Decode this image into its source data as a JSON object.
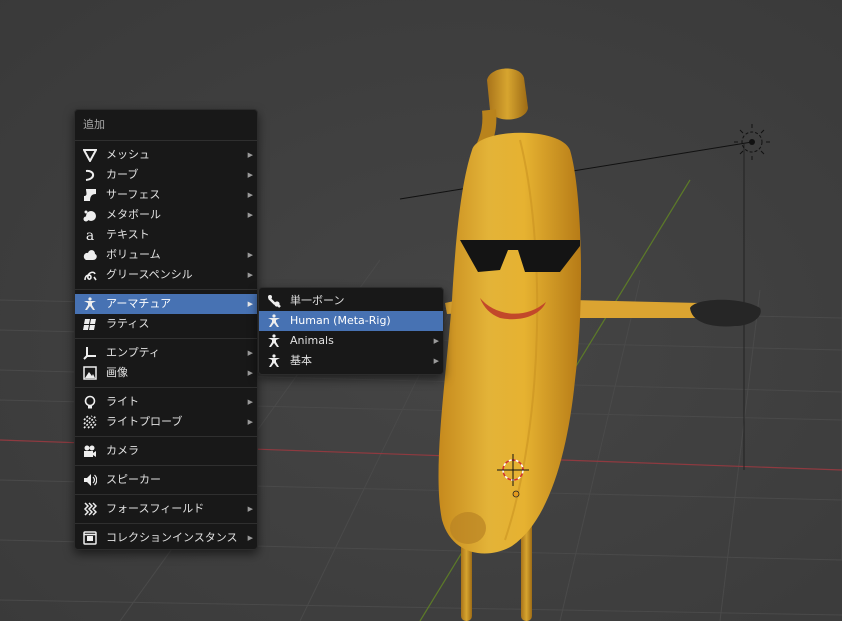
{
  "menu": {
    "title": "追加",
    "groups": [
      [
        {
          "label": "メッシュ",
          "icon": "mesh-cone-icon",
          "submenu": true
        },
        {
          "label": "カーブ",
          "icon": "curve-icon",
          "submenu": true
        },
        {
          "label": "サーフェス",
          "icon": "surface-icon",
          "submenu": true
        },
        {
          "label": "メタボール",
          "icon": "metaball-icon",
          "submenu": true
        },
        {
          "label": "テキスト",
          "icon": "text-icon",
          "submenu": false
        },
        {
          "label": "ボリューム",
          "icon": "volume-icon",
          "submenu": true
        },
        {
          "label": "グリースペンシル",
          "icon": "grease-pencil-icon",
          "submenu": true
        }
      ],
      [
        {
          "label": "アーマチュア",
          "icon": "armature-icon",
          "submenu": true,
          "active": true
        },
        {
          "label": "ラティス",
          "icon": "lattice-icon",
          "submenu": false
        }
      ],
      [
        {
          "label": "エンプティ",
          "icon": "empty-axes-icon",
          "submenu": true
        },
        {
          "label": "画像",
          "icon": "image-icon",
          "submenu": true
        }
      ],
      [
        {
          "label": "ライト",
          "icon": "light-bulb-icon",
          "submenu": true
        },
        {
          "label": "ライトプローブ",
          "icon": "light-probe-icon",
          "submenu": true
        }
      ],
      [
        {
          "label": "カメラ",
          "icon": "camera-icon",
          "submenu": false
        }
      ],
      [
        {
          "label": "スピーカー",
          "icon": "speaker-icon",
          "submenu": false
        }
      ],
      [
        {
          "label": "フォースフィールド",
          "icon": "force-field-icon",
          "submenu": true
        }
      ],
      [
        {
          "label": "コレクションインスタンス",
          "icon": "collection-instance-icon",
          "submenu": true
        }
      ]
    ]
  },
  "submenu": {
    "items": [
      {
        "label": "単一ボーン",
        "icon": "bone-icon",
        "submenu": false
      },
      {
        "label": "Human (Meta-Rig)",
        "icon": "armature-icon",
        "submenu": false,
        "active": true
      },
      {
        "label": "Animals",
        "icon": "armature-icon",
        "submenu": true
      },
      {
        "label": "基本",
        "icon": "armature-icon",
        "submenu": true
      }
    ]
  },
  "colors": {
    "viewport_bg": "#3d3d3d",
    "menu_bg": "#181818",
    "highlight": "#4772b3",
    "axis_x": "#9b3b42",
    "axis_y": "#5f7a2a",
    "banana": "#e0ac2c"
  }
}
